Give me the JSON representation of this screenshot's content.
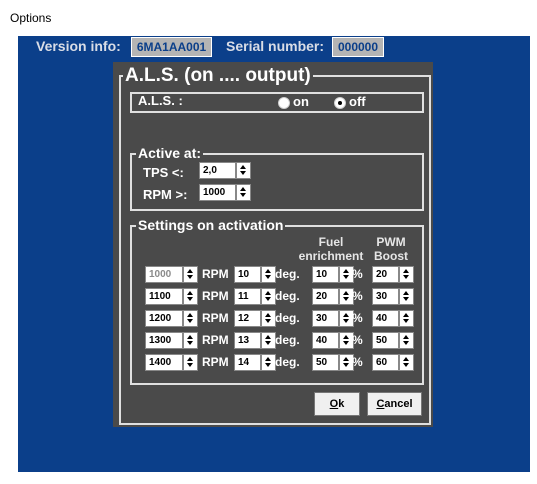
{
  "window": {
    "title": "Options"
  },
  "header": {
    "version_label": "Version info:",
    "version_value": "6MA1AA001",
    "serial_label": "Serial number:",
    "serial_value": "000000"
  },
  "als": {
    "title": "A.L.S. (on .... output)",
    "label": "A.L.S. :",
    "on_label": "on",
    "off_label": "off",
    "selected": "off"
  },
  "active_at": {
    "title": "Active at:",
    "tps_label": "TPS <:",
    "tps_value": "2,0",
    "rpm_label": "RPM >:",
    "rpm_value": "1000"
  },
  "settings": {
    "title": "Settings on activation",
    "fuel_header_1": "Fuel",
    "fuel_header_2": "enrichment",
    "pwm_header_1": "PWM",
    "pwm_header_2": "Boost",
    "rpm_unit": "RPM",
    "deg_unit": "deg.",
    "pct_unit": "%",
    "rows": [
      {
        "rpm": "1000",
        "deg": "10",
        "fuel": "10",
        "pwm": "20"
      },
      {
        "rpm": "1100",
        "deg": "11",
        "fuel": "20",
        "pwm": "30"
      },
      {
        "rpm": "1200",
        "deg": "12",
        "fuel": "30",
        "pwm": "40"
      },
      {
        "rpm": "1300",
        "deg": "13",
        "fuel": "40",
        "pwm": "50"
      },
      {
        "rpm": "1400",
        "deg": "14",
        "fuel": "50",
        "pwm": "60"
      }
    ]
  },
  "buttons": {
    "ok_hot": "O",
    "ok_rest": "k",
    "cancel_hot": "C",
    "cancel_rest": "ancel"
  },
  "colors": {
    "background": "#0b3f8a",
    "panel": "#4a4a4a"
  }
}
